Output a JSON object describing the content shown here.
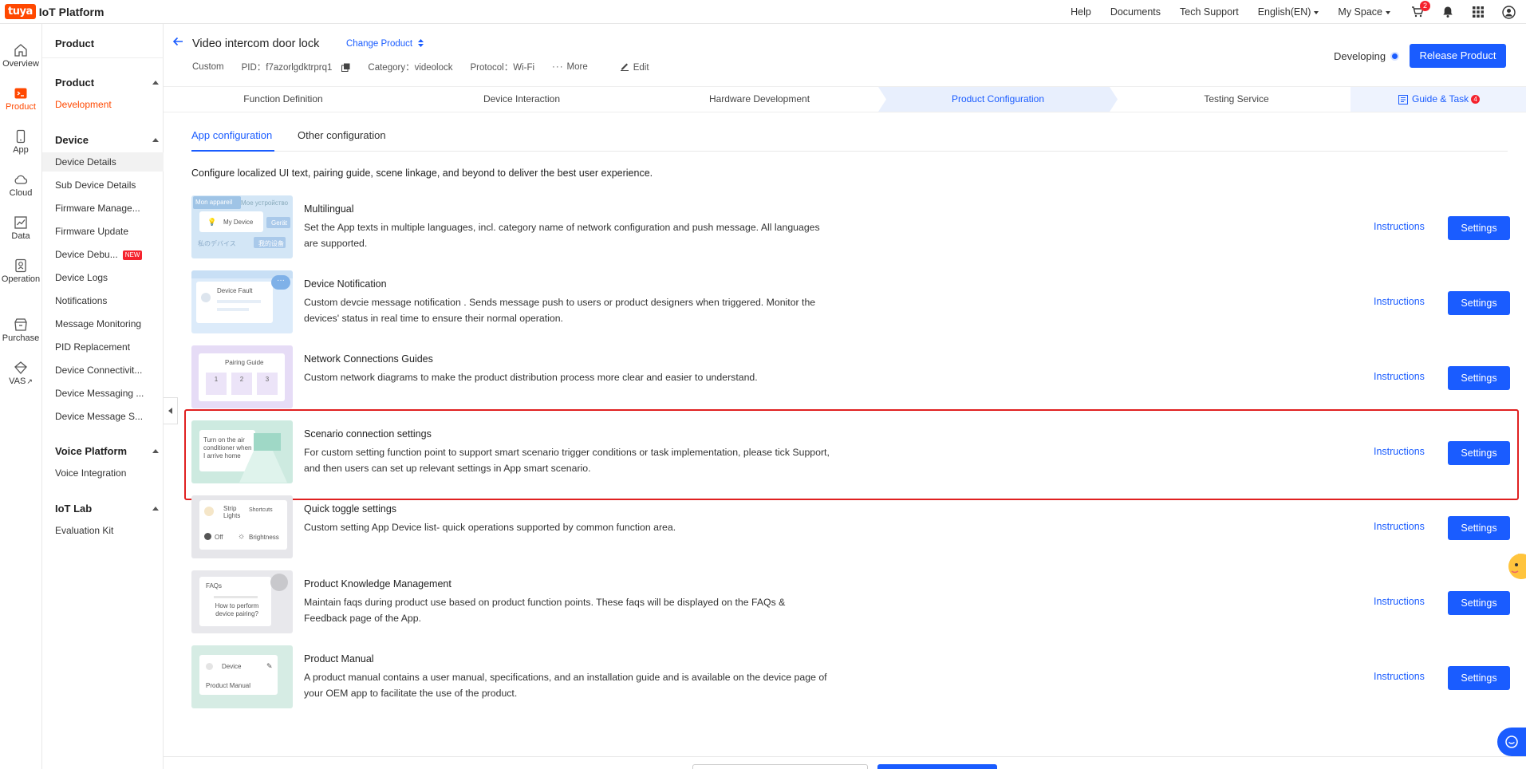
{
  "brand": {
    "badge": "tuya",
    "name": "IoT Platform"
  },
  "topnav": {
    "help": "Help",
    "documents": "Documents",
    "tech_support": "Tech Support",
    "language": "English(EN)",
    "space": "My Space",
    "cart_count": "2"
  },
  "rail": [
    {
      "label": "Overview",
      "icon": "home-icon"
    },
    {
      "label": "Product",
      "icon": "terminal-icon"
    },
    {
      "label": "App",
      "icon": "phone-icon"
    },
    {
      "label": "Cloud",
      "icon": "cloud-icon"
    },
    {
      "label": "Data",
      "icon": "chart-icon"
    },
    {
      "label": "Operation",
      "icon": "badge-icon"
    },
    {
      "label": "Purchase",
      "icon": "store-icon"
    },
    {
      "label": "VAS",
      "icon": "diamond-icon"
    }
  ],
  "sidenav": {
    "title": "Product",
    "groups": [
      {
        "label": "Product",
        "items": [
          "Development"
        ]
      },
      {
        "label": "Device",
        "items": [
          "Device Details",
          "Sub Device Details",
          "Firmware Manage...",
          "Firmware Update",
          "Device Debu...",
          "Device Logs",
          "Notifications",
          "Message Monitoring",
          "PID Replacement",
          "Device Connectivit...",
          "Device Messaging ...",
          "Device Message S..."
        ]
      },
      {
        "label": "Voice Platform",
        "items": [
          "Voice Integration"
        ]
      },
      {
        "label": "IoT Lab",
        "items": [
          "Evaluation Kit"
        ]
      }
    ],
    "new_badge": "NEW"
  },
  "product": {
    "title": "Video intercom door lock",
    "change": "Change Product",
    "type": "Custom",
    "pid": "PID：f7azorlgdktrprq1",
    "category": "Category：videolock",
    "protocol": "Protocol：Wi-Fi",
    "more": "More",
    "edit": "Edit",
    "status": "Developing",
    "release": "Release Product"
  },
  "steps": [
    "Function Definition",
    "Device Interaction",
    "Hardware Development",
    "Product Configuration",
    "Testing Service"
  ],
  "guide": {
    "label": "Guide & Task",
    "count": "4"
  },
  "tabs": [
    "App configuration",
    "Other configuration"
  ],
  "intro": "Configure localized UI text, pairing guide, scene linkage, and beyond to deliver the best user experience.",
  "instructions_label": "Instructions",
  "settings_label": "Settings",
  "configs": [
    {
      "title": "Multilingual",
      "desc": "Set the App texts in multiple languages, incl. category name of network configuration and push message. All languages are supported.",
      "thumb": {
        "t1": "Mon appareil",
        "t2": "Мое устройство",
        "t3": "My Device",
        "t4": "私のデバイス",
        "t5": "我的设备",
        "t6": "Gerät"
      }
    },
    {
      "title": "Device Notification",
      "desc": "Custom devcie message notification . Sends message push to users or product designers when triggered. Monitor the devices' status in real time to ensure their normal operation.",
      "thumb": {
        "t1": "Device Fault"
      }
    },
    {
      "title": "Network Connections Guides",
      "desc": "Custom network diagrams to make the product distribution process more clear and easier to understand.",
      "thumb": {
        "t1": "Pairing Guide",
        "n1": "1",
        "n2": "2",
        "n3": "3"
      }
    },
    {
      "title": "Scenario connection settings",
      "desc": "For custom setting function point to support smart scenario trigger conditions or task implementation, please tick Support, and then users can set up relevant settings in App smart scenario.",
      "thumb": {
        "t1": "Turn on the air conditioner when I arrive home"
      }
    },
    {
      "title": "Quick toggle settings",
      "desc": "Custom setting App Device list- quick operations supported by common function area.",
      "thumb": {
        "t1": "Strip Lights",
        "t2": "Shortcuts",
        "t3": "Off",
        "t4": "Brightness"
      }
    },
    {
      "title": "Product Knowledge Management",
      "desc": "Maintain faqs during product use based on product function points. These faqs will be displayed on the FAQs & Feedback page of the App.",
      "thumb": {
        "t1": "FAQs",
        "t2": "How to perform device pairing?"
      }
    },
    {
      "title": "Product Manual",
      "desc": "A product manual contains a user manual, specifications, and an installation guide and is available on the device page of your OEM app to facilitate the use of the product.",
      "thumb": {
        "t1": "Device",
        "t2": "Product Manual"
      }
    }
  ],
  "colors": {
    "primary": "#1a5cff",
    "brand": "#ff4800",
    "highlight": "#e02020"
  }
}
